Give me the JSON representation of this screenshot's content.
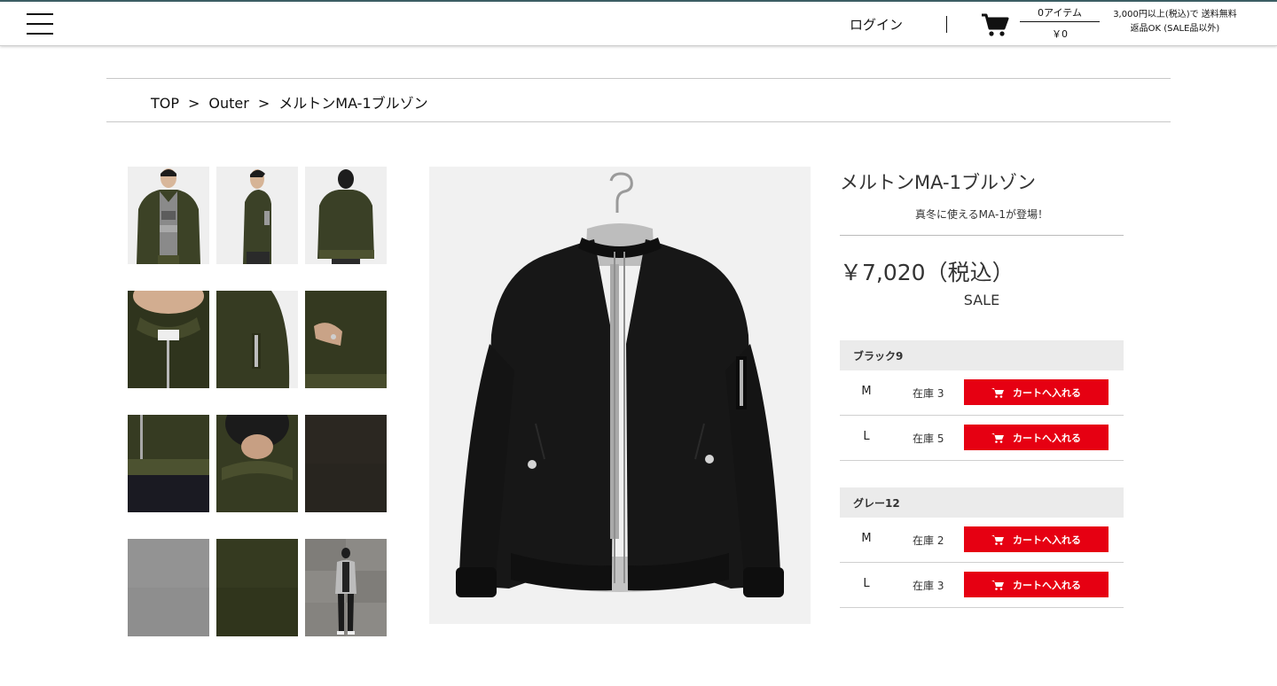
{
  "header": {
    "menu_icon": "hamburger-menu-icon",
    "login_label": "ログイン",
    "cart_icon": "shopping-cart-icon",
    "cart_count": "0アイテム",
    "cart_total": "￥0",
    "shipping_line1": "3,000円以上(税込)で 送料無料",
    "shipping_line2": "返品OK (SALE品以外)"
  },
  "breadcrumb": {
    "items": [
      "TOP",
      "Outer",
      "メルトンMA-1ブルゾン"
    ],
    "separator": ">"
  },
  "gallery": {
    "thumbnails": [
      {
        "alt": "front view model wearing jacket"
      },
      {
        "alt": "side view model"
      },
      {
        "alt": "back view model"
      },
      {
        "alt": "collar close-up"
      },
      {
        "alt": "sleeve pocket close-up"
      },
      {
        "alt": "side pocket close-up"
      },
      {
        "alt": "hem rib close-up"
      },
      {
        "alt": "back collar close-up"
      },
      {
        "alt": "fabric texture black"
      },
      {
        "alt": "fabric texture grey"
      },
      {
        "alt": "fabric texture khaki"
      },
      {
        "alt": "model full body street"
      }
    ],
    "main_image_alt": "black melton MA-1 blouson on hanger"
  },
  "product": {
    "title": "メルトンMA-1ブルゾン",
    "catch_copy": "真冬に使えるMA-1が登場！",
    "price": "￥7,020（税込）",
    "sale_label": "SALE",
    "variants": [
      {
        "color": "ブラック9",
        "sizes": [
          {
            "size": "M",
            "stock": "在庫 3",
            "button": "カートへ入れる"
          },
          {
            "size": "L",
            "stock": "在庫 5",
            "button": "カートへ入れる"
          }
        ]
      },
      {
        "color": "グレー12",
        "sizes": [
          {
            "size": "M",
            "stock": "在庫 2",
            "button": "カートへ入れる"
          },
          {
            "size": "L",
            "stock": "在庫 3",
            "button": "カートへ入れる"
          }
        ]
      }
    ]
  },
  "colors": {
    "header_rule": "#3d5f66",
    "cart_button": "#e60012",
    "variant_header_bg": "#ebebeb"
  }
}
